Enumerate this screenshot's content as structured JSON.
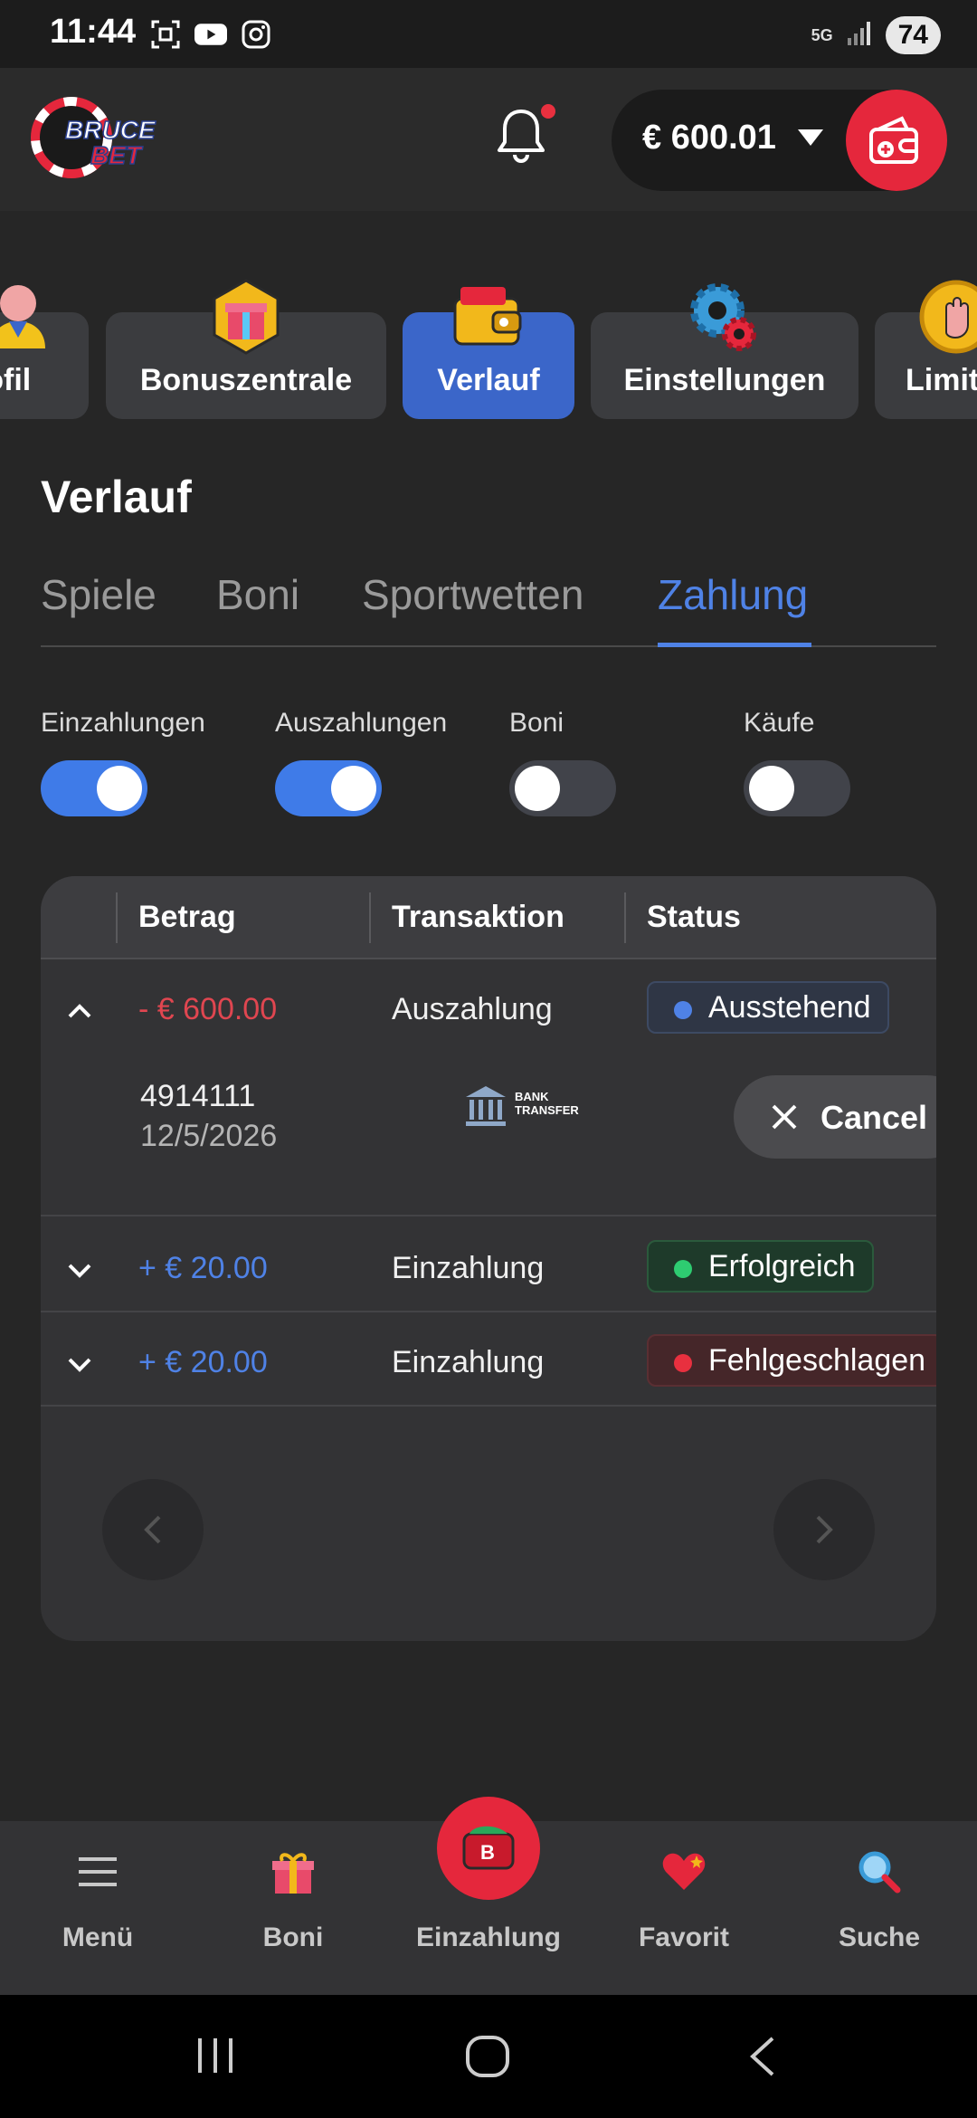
{
  "status_bar": {
    "time": "11:44",
    "network": "5G",
    "battery": "74",
    "icons": [
      "screenshot-icon",
      "youtube-icon",
      "instagram-icon",
      "signal-icon"
    ]
  },
  "header": {
    "logo_text_1": "BRUCE",
    "logo_text_2": "BET",
    "balance": "€ 600.01",
    "accent": "#e5273c"
  },
  "categories": [
    {
      "label": "Profil"
    },
    {
      "label": "Bonuszentrale"
    },
    {
      "label": "Verlauf",
      "active": true
    },
    {
      "label": "Einstellungen"
    },
    {
      "label": "Limit"
    }
  ],
  "page": {
    "title": "Verlauf",
    "tabs": [
      "Spiele",
      "Boni",
      "Sportwetten",
      "Zahlung"
    ],
    "active_tab": "Zahlung"
  },
  "filters": [
    {
      "label": "Einzahlungen",
      "on": true
    },
    {
      "label": "Auszahlungen",
      "on": true
    },
    {
      "label": "Boni",
      "on": false
    },
    {
      "label": "Käufe",
      "on": false
    }
  ],
  "table": {
    "headers": [
      "Betrag",
      "Transaktion",
      "Status"
    ],
    "rows": [
      {
        "amount": "- € 600.00",
        "type": "Auszahlung",
        "status": "Ausstehend",
        "expanded": true,
        "id": "4914111",
        "date": "12/5/2026",
        "method_line1": "BANK",
        "method_line2": "TRANSFER",
        "action": "Cancel"
      },
      {
        "amount": "+ € 20.00",
        "type": "Einzahlung",
        "status": "Erfolgreich"
      },
      {
        "amount": "+ € 20.00",
        "type": "Einzahlung",
        "status": "Fehlgeschlagen"
      }
    ]
  },
  "bottom_nav": [
    {
      "label": "Menü"
    },
    {
      "label": "Boni"
    },
    {
      "label": "Einzahlung"
    },
    {
      "label": "Favorit"
    },
    {
      "label": "Suche"
    }
  ]
}
